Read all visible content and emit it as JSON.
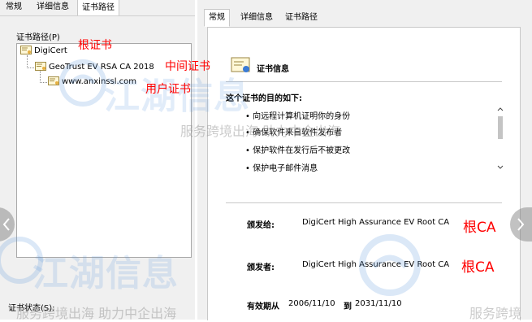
{
  "left_dialog": {
    "tabs": [
      "常规",
      "详细信息",
      "证书路径"
    ],
    "active_tab": 2,
    "path_group_label": "证书路径(P)",
    "tree": [
      {
        "label": "DigiCert",
        "level": 0
      },
      {
        "label": "GeoTrust EV RSA CA 2018",
        "level": 1
      },
      {
        "label": "www.anxinssl.com",
        "level": 2
      }
    ],
    "status_label": "证书状态(S):"
  },
  "right_dialog": {
    "tabs": [
      "常规",
      "详细信息",
      "证书路径"
    ],
    "active_tab": 0,
    "info_title": "证书信息",
    "purpose_heading": "这个证书的目的如下:",
    "purposes": [
      "• 向远程计算机证明你的身份",
      "• 确保软件来自软件发布者",
      "• 保护软件在发行后不被更改",
      "• 保护电子邮件消息"
    ],
    "issued_to_label": "颁发给:",
    "issued_to_value": "DigiCert High Assurance EV Root CA",
    "issued_by_label": "颁发者:",
    "issued_by_value": "DigiCert High Assurance EV Root CA",
    "validity_label": "有效期从",
    "valid_from": "2006/11/10",
    "validity_to_label": "到",
    "valid_to": "2031/11/10"
  },
  "annotations": {
    "root_cert": "根证书",
    "intermediate_cert": "中间证书",
    "user_cert": "用户证书",
    "root_ca_1": "根CA",
    "root_ca_2": "根CA"
  },
  "watermark": {
    "logo_text": "江湖信息",
    "slogan_1": "服务跨境出海 助力中企出海",
    "slogan_2": "服务跨境出海 助力中企出海",
    "slogan_3": "服务跨境"
  },
  "colors": {
    "annotation": "#ff0000",
    "dialog_bg": "#f0f0f0"
  }
}
